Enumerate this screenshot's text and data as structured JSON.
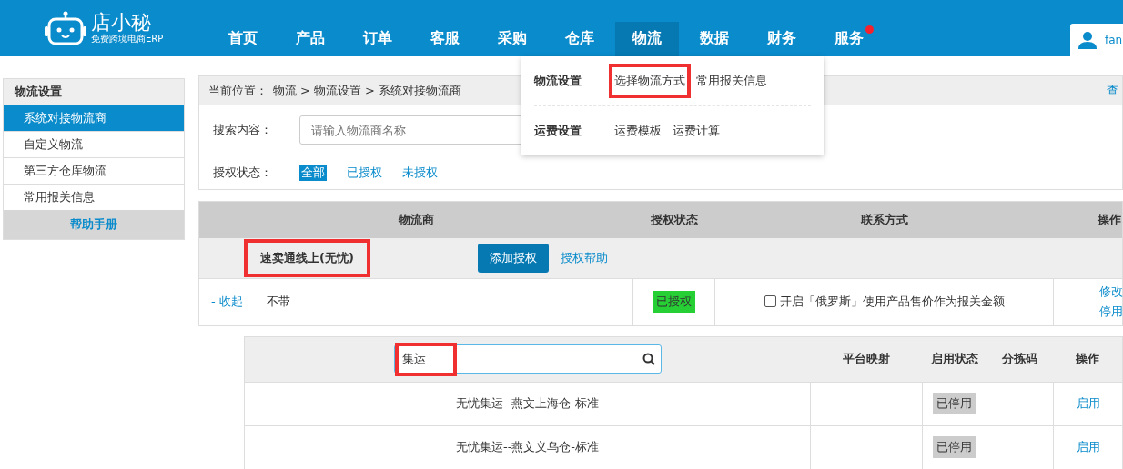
{
  "logo": {
    "name": "店小秘",
    "tagline": "免费跨境电商ERP"
  },
  "nav": [
    {
      "label": "首页",
      "selected": false,
      "badge": false
    },
    {
      "label": "产品",
      "selected": false,
      "badge": false
    },
    {
      "label": "订单",
      "selected": false,
      "badge": false
    },
    {
      "label": "客服",
      "selected": false,
      "badge": false
    },
    {
      "label": "采购",
      "selected": false,
      "badge": false
    },
    {
      "label": "仓库",
      "selected": false,
      "badge": false
    },
    {
      "label": "物流",
      "selected": true,
      "badge": false
    },
    {
      "label": "数据",
      "selected": false,
      "badge": false
    },
    {
      "label": "财务",
      "selected": false,
      "badge": false
    },
    {
      "label": "服务",
      "selected": false,
      "badge": true
    }
  ],
  "user": {
    "name": "fan"
  },
  "dropdown": {
    "groups": [
      {
        "title": "物流设置",
        "links": [
          {
            "label": "选择物流方式",
            "highlighted": true
          },
          {
            "label": "常用报关信息",
            "highlighted": false
          }
        ]
      },
      {
        "title": "运费设置",
        "links": [
          {
            "label": "运费模板",
            "highlighted": false
          },
          {
            "label": "运费计算",
            "highlighted": false
          }
        ]
      }
    ]
  },
  "sidebar": {
    "title": "物流设置",
    "items": [
      {
        "label": "系统对接物流商",
        "selected": true
      },
      {
        "label": "自定义物流",
        "selected": false
      },
      {
        "label": "第三方仓库物流",
        "selected": false
      },
      {
        "label": "常用报关信息",
        "selected": false
      }
    ],
    "help": "帮助手册"
  },
  "breadcrumb": {
    "prefix": "当前位置：",
    "separator": ">",
    "path": [
      "物流",
      "物流设置",
      "系统对接物流商"
    ],
    "right_link": "查"
  },
  "search": {
    "label": "搜索内容：",
    "placeholder": "请输入物流商名称"
  },
  "auth_filter": {
    "label": "授权状态：",
    "options": [
      {
        "label": "全部",
        "selected": true
      },
      {
        "label": "已授权",
        "selected": false
      },
      {
        "label": "未授权",
        "selected": false
      }
    ]
  },
  "carriers": {
    "columns": [
      "物流商",
      "授权状态",
      "联系方式",
      "操作"
    ],
    "group": {
      "name": "速卖通线上(无忧)",
      "highlighted": true,
      "add_button": "添加授权",
      "help_link": "授权帮助"
    },
    "row": {
      "toggle": "- 收起",
      "name": "不带",
      "status": "已授权",
      "authorized": true,
      "option": {
        "label": "开启「俄罗斯」使用产品售价作为报关金额",
        "checked": false
      },
      "actions": [
        "修改",
        "停用"
      ]
    }
  },
  "methods": {
    "search": {
      "value": "集运",
      "highlighted": true
    },
    "columns": [
      "平台映射",
      "启用状态",
      "分拣码",
      "操作"
    ],
    "rows": [
      {
        "name": "无忧集运--燕文上海仓-标准",
        "status": "已停用",
        "enabled": false,
        "action": "启用"
      },
      {
        "name": "无忧集运--燕文义乌仓-标准",
        "status": "已停用",
        "enabled": false,
        "action": "启用"
      }
    ]
  }
}
